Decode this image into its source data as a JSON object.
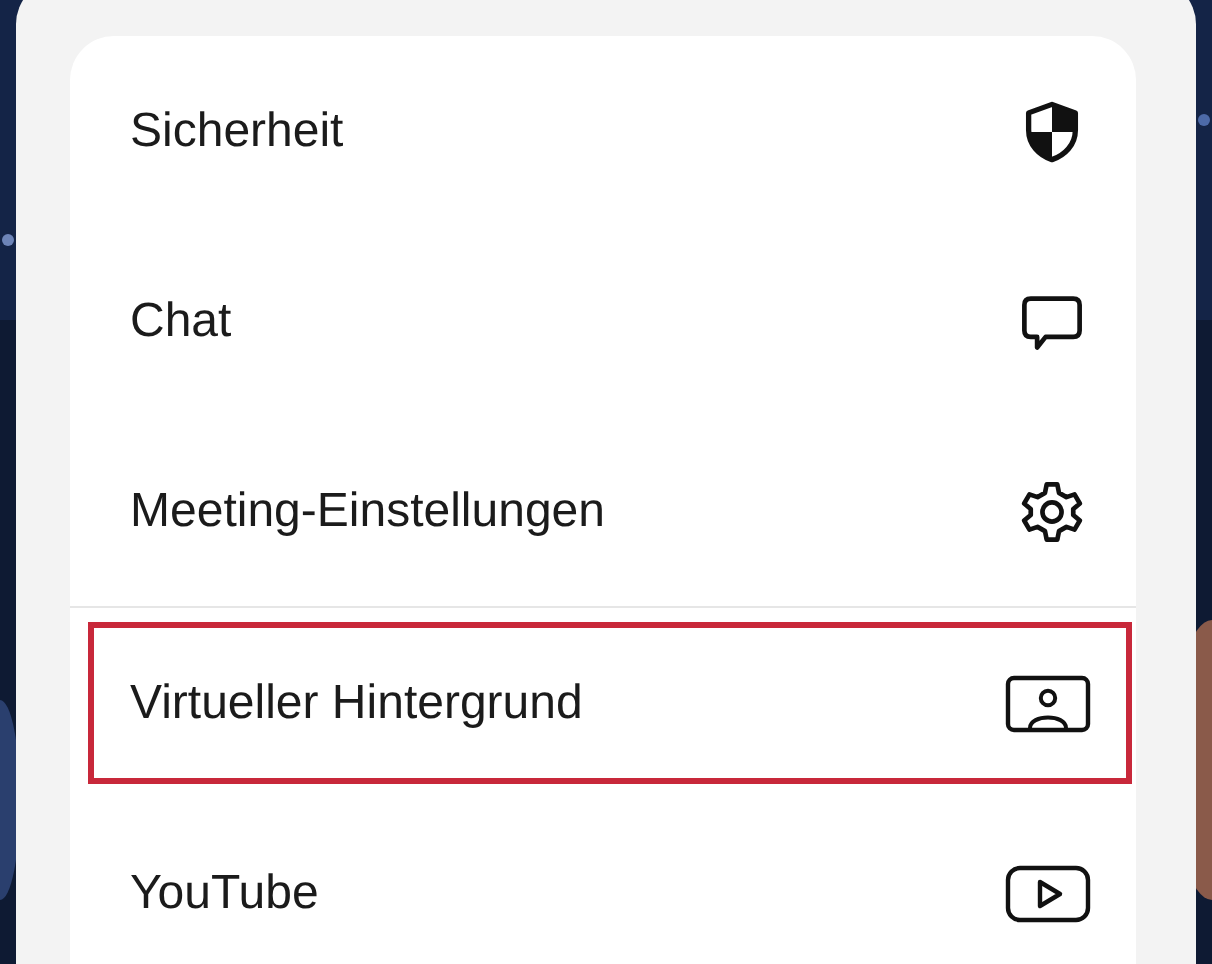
{
  "menu_groups": [
    {
      "items": [
        {
          "label": "Sicherheit",
          "kind": "shield",
          "highlighted": false
        },
        {
          "label": "Chat",
          "kind": "chat",
          "highlighted": false
        },
        {
          "label": "Meeting-Einstellungen",
          "kind": "gear",
          "highlighted": false
        }
      ]
    },
    {
      "items": [
        {
          "label": "Virtueller Hintergrund",
          "kind": "portrait",
          "highlighted": true
        },
        {
          "label": "YouTube",
          "kind": "play",
          "highlighted": false
        }
      ]
    }
  ]
}
